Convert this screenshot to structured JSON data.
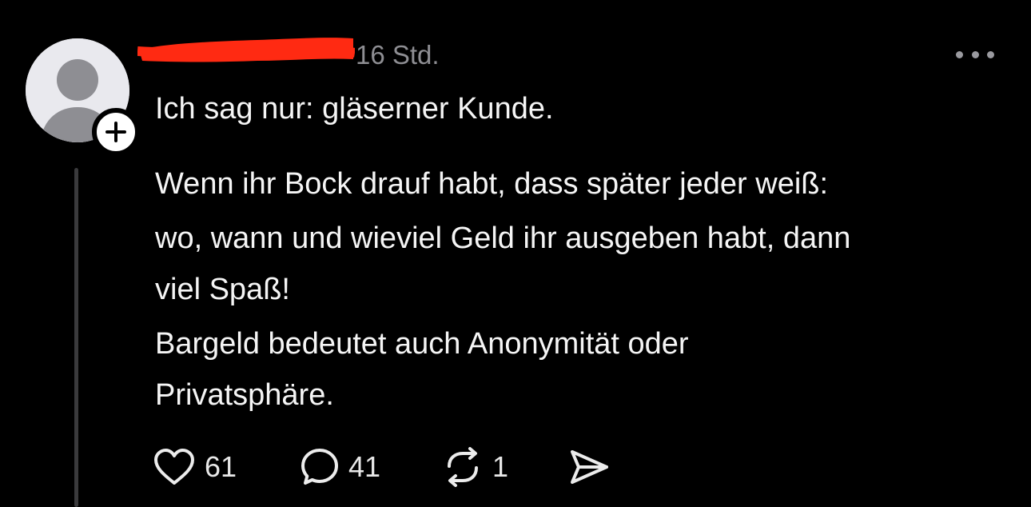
{
  "post": {
    "timestamp": "16 Std.",
    "redaction_color": "#ff2a12",
    "text": {
      "line1": "Ich sag nur: gläserner Kunde.",
      "line2": "Wenn ihr Bock drauf habt, dass später jeder weiß:",
      "line3": "wo, wann und wieviel Geld ihr ausgeben habt, dann",
      "line4": "viel Spaß!",
      "line5": "Bargeld bedeutet auch Anonymität oder",
      "line6": "Privatsphäre."
    },
    "actions": {
      "likes": "61",
      "replies": "41",
      "reposts": "1"
    },
    "icons": {
      "avatar": "default-avatar-icon",
      "follow": "plus-icon",
      "more": "more-horizontal-icon",
      "like": "heart-icon",
      "reply": "speech-bubble-icon",
      "repost": "repost-icon",
      "share": "send-icon"
    }
  }
}
